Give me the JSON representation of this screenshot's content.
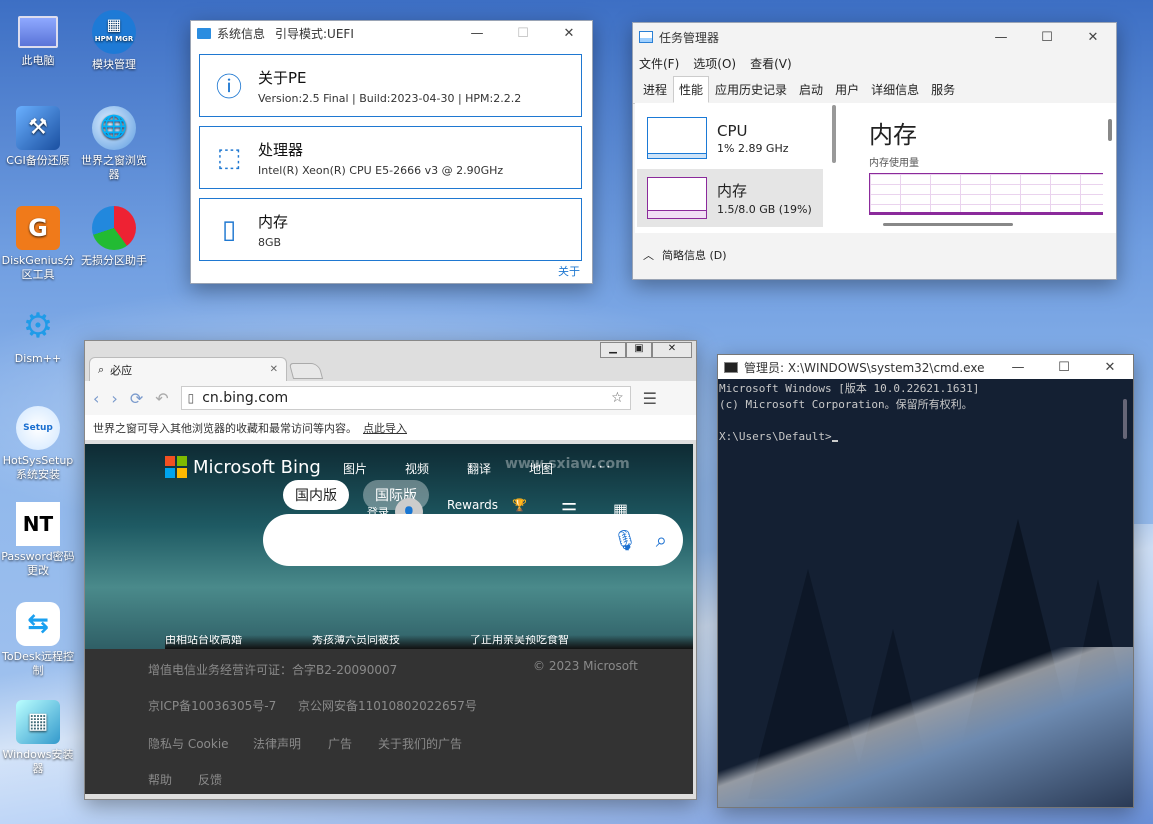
{
  "desktop": {
    "icons": [
      {
        "label": "此电脑",
        "icon": "monitor-icon"
      },
      {
        "label": "模块管理",
        "icon": "hpm-mgr-icon",
        "badge": "HPM MGR"
      },
      {
        "label": "CGI备份还原",
        "icon": "cgi-tools-icon"
      },
      {
        "label": "世界之窗浏览器",
        "icon": "globe-icon"
      },
      {
        "label": "DiskGenius分区工具",
        "icon": "diskgenius-icon",
        "badge": "G"
      },
      {
        "label": "无损分区助手",
        "icon": "partition-assistant-icon"
      },
      {
        "label": "Dism++",
        "icon": "gears-icon"
      },
      {
        "label": "HotSysSetup系统安装",
        "icon": "setup-icon",
        "badge": "Setup"
      },
      {
        "label": "Password密码更改",
        "icon": "password-key-icon",
        "badge": "NT"
      },
      {
        "label": "ToDesk远程控制",
        "icon": "todesk-icon"
      },
      {
        "label": "Windows安装器",
        "icon": "windows-installer-icon"
      }
    ]
  },
  "sysinfo": {
    "title": "系统信息",
    "boot_mode": "引导模式:UEFI",
    "cards": [
      {
        "title": "关于PE",
        "detail": "Version:2.5 Final | Build:2023-04-30 | HPM:2.2.2",
        "icon": "info-icon"
      },
      {
        "title": "处理器",
        "detail": "Intel(R) Xeon(R) CPU E5-2666 v3 @ 2.90GHz",
        "icon": "cpu-icon"
      },
      {
        "title": "内存",
        "detail": "8GB",
        "icon": "memory-icon"
      }
    ],
    "about_link": "关于"
  },
  "taskmgr": {
    "title": "任务管理器",
    "menu": [
      "文件(F)",
      "选项(O)",
      "查看(V)"
    ],
    "tabs": [
      "进程",
      "性能",
      "应用历史记录",
      "启动",
      "用户",
      "详细信息",
      "服务"
    ],
    "active_tab": "性能",
    "resources": [
      {
        "name": "CPU",
        "value": "1% 2.89 GHz"
      },
      {
        "name": "内存",
        "value": "1.5/8.0 GB (19%)"
      }
    ],
    "panel_title": "内存",
    "panel_subtitle": "内存使用量",
    "summary": "简略信息 (D)",
    "colors": {
      "cpu": "#1b7ad6",
      "memory": "#8b2a9b"
    }
  },
  "browser": {
    "tab_title": "必应",
    "url": "cn.bing.com",
    "import_bar": "世界之窗可导入其他浏览器的收藏和最常访问等内容。",
    "import_link": "点此导入",
    "bing": {
      "logo": "Microsoft Bing",
      "nav": [
        "图片",
        "视频",
        "翻译",
        "地图",
        "· · ·"
      ],
      "version_cn": "国内版",
      "version_intl": "国际版",
      "login": "登录",
      "rewards": "Rewards",
      "watermark": "www.sxiaw.com",
      "news": [
        "由相站台收高婚",
        "秀孩薄六员同被技",
        "了正用亲吴预吃食智"
      ]
    },
    "footer": {
      "license": "增值电信业务经营许可证：合字B2-20090007",
      "copyright": "© 2023 Microsoft",
      "icp": "京ICP备10036305号-7",
      "police": "京公网安备11010802022657号",
      "links": [
        "隐私与 Cookie",
        "法律声明",
        "广告",
        "关于我们的广告"
      ],
      "links2": [
        "帮助",
        "反馈"
      ]
    }
  },
  "cmd": {
    "title": "管理员: X:\\WINDOWS\\system32\\cmd.exe",
    "lines": [
      "Microsoft Windows [版本 10.0.22621.1631]",
      "(c) Microsoft Corporation。保留所有权利。",
      "",
      "X:\\Users\\Default>"
    ]
  }
}
